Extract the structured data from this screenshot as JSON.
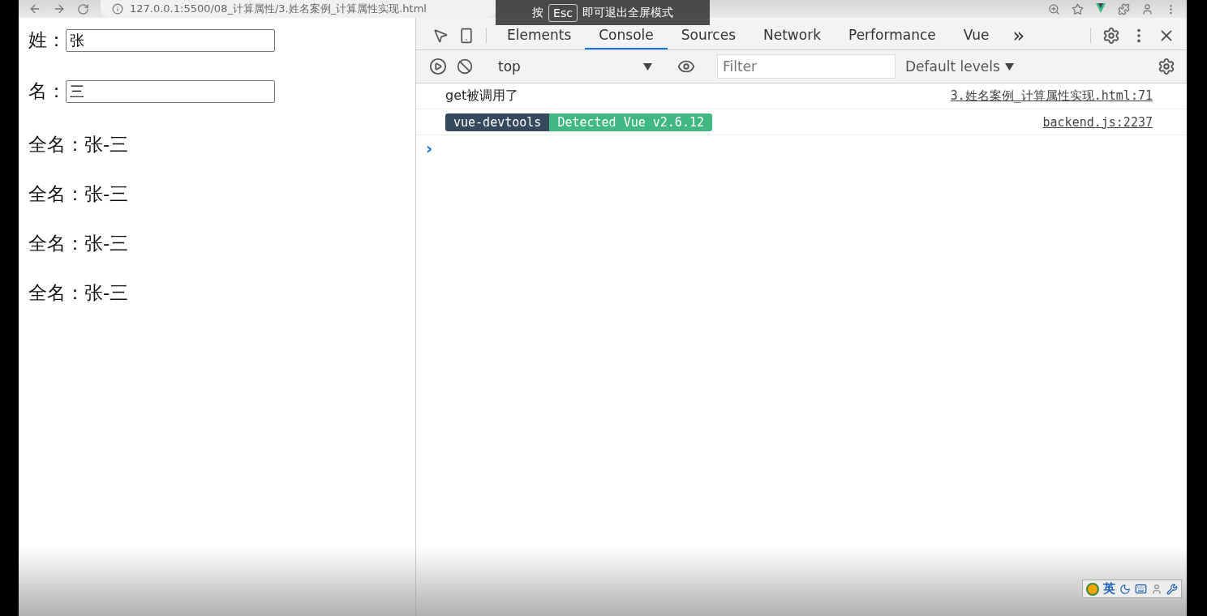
{
  "browser": {
    "url": "127.0.0.1:5500/08_计算属性/3.姓名案例_计算属性实现.html"
  },
  "fullscreen_notice": {
    "prefix": "按",
    "key": "Esc",
    "suffix": "即可退出全屏模式"
  },
  "page": {
    "fields": [
      {
        "label": "姓：",
        "value": "张"
      },
      {
        "label": "名：",
        "value": "三"
      }
    ],
    "full_names": [
      "全名：张-三",
      "全名：张-三",
      "全名：张-三",
      "全名：张-三"
    ]
  },
  "devtools": {
    "tabs": [
      {
        "label": "Elements",
        "selected": false
      },
      {
        "label": "Console",
        "selected": true
      },
      {
        "label": "Sources",
        "selected": false
      },
      {
        "label": "Network",
        "selected": false
      },
      {
        "label": "Performance",
        "selected": false
      },
      {
        "label": "Vue",
        "selected": false
      }
    ],
    "more": "»",
    "context": "top",
    "filter_placeholder": "Filter",
    "levels": "Default levels",
    "messages": [
      {
        "kind": "log",
        "text": "get被调用了",
        "source": "3.姓名案例_计算属性实现.html:71"
      },
      {
        "kind": "badges",
        "badges": [
          "vue-devtools",
          "Detected Vue v2.6.12"
        ],
        "source": "backend.js:2237"
      }
    ],
    "prompt": "›"
  },
  "ime_toolbar": {
    "language": "英"
  }
}
